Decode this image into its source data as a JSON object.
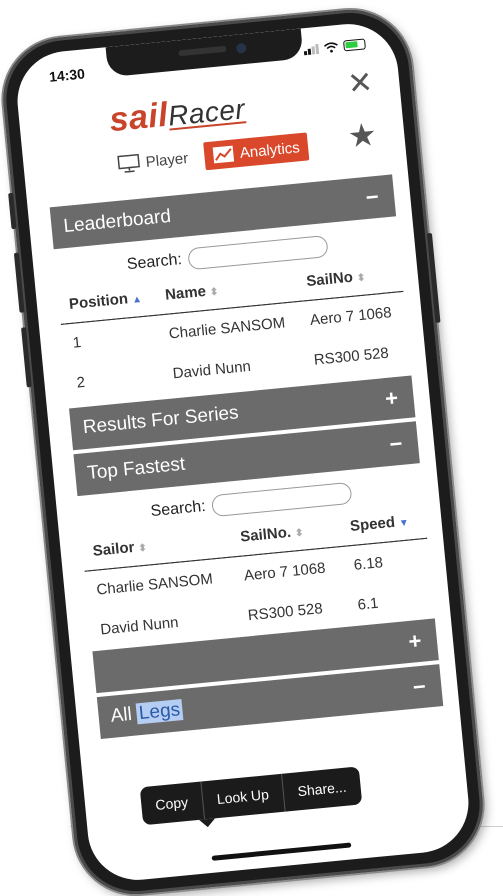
{
  "status": {
    "time": "14:30"
  },
  "brand": {
    "logo_main": "sail",
    "logo_accent": "Racer"
  },
  "icons": {
    "close": "close-icon",
    "star": "star-icon",
    "player": "monitor-icon",
    "analytics": "chart-icon",
    "battery": "battery-icon",
    "wifi": "wifi-icon",
    "signal": "signal-icon"
  },
  "tabs": [
    {
      "label": "Player",
      "active": false
    },
    {
      "label": "Analytics",
      "active": true
    }
  ],
  "leaderboard": {
    "title": "Leaderboard",
    "toggle": "−",
    "search_label": "Search:",
    "columns": [
      "Position",
      "Name",
      "SailNo"
    ],
    "rows": [
      {
        "position": "1",
        "name": "Charlie SANSOM",
        "sailno": "Aero 7 1068"
      },
      {
        "position": "2",
        "name": "David Nunn",
        "sailno": "RS300 528"
      }
    ]
  },
  "results": {
    "title": "Results For Series",
    "toggle": "+"
  },
  "fastest": {
    "title": "Top Fastest",
    "toggle": "−",
    "search_label": "Search:",
    "columns": [
      "Sailor",
      "SailNo.",
      "Speed"
    ],
    "rows": [
      {
        "sailor": "Charlie SANSOM",
        "sailno": "Aero 7 1068",
        "speed": "6.18"
      },
      {
        "sailor": "David Nunn",
        "sailno": "RS300 528",
        "speed": "6.1"
      }
    ]
  },
  "collapsed": {
    "toggle": "+"
  },
  "legs": {
    "title_prefix": "All ",
    "title_selected": "Legs",
    "toggle": "−"
  },
  "context_menu": {
    "copy": "Copy",
    "lookup": "Look Up",
    "share": "Share..."
  },
  "colors": {
    "accent": "#d9482b",
    "panel": "#6b6b6b",
    "selection": "#b5cdf2"
  }
}
